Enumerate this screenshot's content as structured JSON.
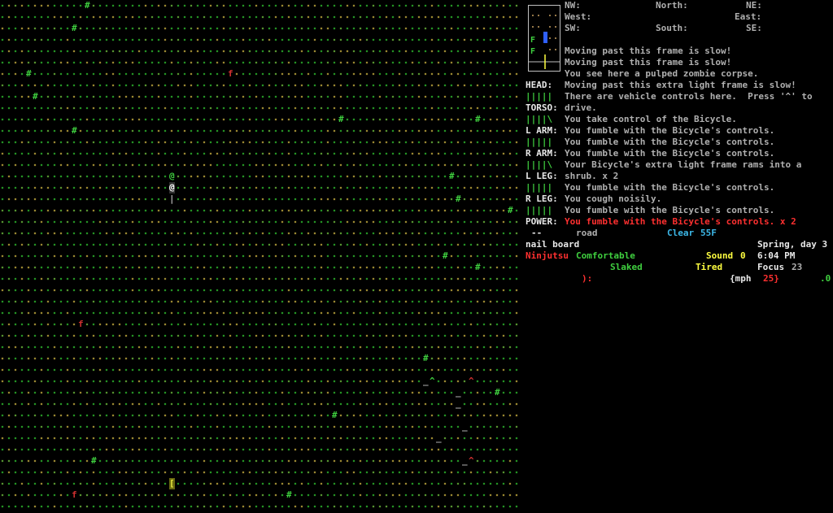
{
  "compass": {
    "nw": "NW:",
    "north": "North:",
    "ne": "NE:",
    "west": "West:",
    "east": "East:",
    "sw": "SW:",
    "south": "South:",
    "se": "SE:"
  },
  "body_status": [
    {
      "label": "HEAD:",
      "bar": "|||||"
    },
    {
      "label": "TORSO:",
      "bar": "||||\\"
    },
    {
      "label": "L ARM:",
      "bar": "|||||"
    },
    {
      "label": "R ARM:",
      "bar": "||||\\"
    },
    {
      "label": "L LEG:",
      "bar": "|||||"
    },
    {
      "label": "R LEG:",
      "bar": "|||||"
    },
    {
      "label": "POWER:",
      "bar": "--"
    }
  ],
  "messages": [
    {
      "text": "Moving past this frame is slow!",
      "color": "#b0b0b0"
    },
    {
      "text": "Moving past this frame is slow!",
      "color": "#b0b0b0"
    },
    {
      "text": "You see here a pulped zombie corpse.",
      "color": "#b0b0b0"
    },
    {
      "text": "Moving past this extra light frame is slow!",
      "color": "#b0b0b0"
    },
    {
      "text": "There are vehicle controls here.  Press '^' to",
      "color": "#b0b0b0"
    },
    {
      "text": "drive.",
      "color": "#b0b0b0"
    },
    {
      "text": "You take control of the Bicycle.",
      "color": "#b0b0b0"
    },
    {
      "text": "You fumble with the Bicycle's controls.",
      "color": "#b0b0b0"
    },
    {
      "text": "You fumble with the Bicycle's controls.",
      "color": "#b0b0b0"
    },
    {
      "text": "You fumble with the Bicycle's controls.",
      "color": "#b0b0b0"
    },
    {
      "text": "Your Bicycle's extra light frame rams into a",
      "color": "#b0b0b0"
    },
    {
      "text": "shrub. x 2",
      "color": "#b0b0b0"
    },
    {
      "text": "You fumble with the Bicycle's controls.",
      "color": "#b0b0b0"
    },
    {
      "text": "You cough noisily.",
      "color": "#b0b0b0"
    },
    {
      "text": "You fumble with the Bicycle's controls.",
      "color": "#b0b0b0"
    },
    {
      "text": "You fumble with the Bicycle's controls. x 2",
      "color": "#ff3030"
    }
  ],
  "status": {
    "terrain": "road",
    "weather": "Clear",
    "temperature": "55F",
    "wielded": "nail board",
    "date": "Spring, day 3",
    "time": "6:04 PM",
    "style": "Ninjutsu",
    "mood": "Comfortable",
    "thirst": "Slaked",
    "sound_label": "Sound",
    "sound_value": "0",
    "fatigue": "Tired",
    "focus_label": "Focus",
    "focus_value": "23",
    "face": "):",
    "speed_unit": "{mph",
    "speed_value": "25}",
    "speed_tail": ".0"
  },
  "map_glyphs": [
    {
      "ch": "#",
      "col": 13,
      "row": 0,
      "color": "#3fcf3f"
    },
    {
      "ch": "#",
      "col": 11,
      "row": 2,
      "color": "#3fcf3f"
    },
    {
      "ch": "#",
      "col": 4,
      "row": 6,
      "color": "#3fcf3f"
    },
    {
      "ch": "f",
      "col": 35,
      "row": 6,
      "color": "#d03030"
    },
    {
      "ch": "#",
      "col": 5,
      "row": 8,
      "color": "#3fcf3f"
    },
    {
      "ch": "#",
      "col": 52,
      "row": 10,
      "color": "#3fcf3f"
    },
    {
      "ch": "#",
      "col": 73,
      "row": 10,
      "color": "#3fcf3f"
    },
    {
      "ch": "#",
      "col": 11,
      "row": 11,
      "color": "#3fcf3f"
    },
    {
      "ch": "#",
      "col": 69,
      "row": 15,
      "color": "#3fcf3f"
    },
    {
      "ch": "@",
      "col": 26,
      "row": 15,
      "color": "#3fcf3f"
    },
    {
      "ch": "@",
      "col": 26,
      "row": 16,
      "color": "#ffffff"
    },
    {
      "ch": "|",
      "col": 26,
      "row": 17,
      "color": "#b0b0b0"
    },
    {
      "ch": "#",
      "col": 70,
      "row": 17,
      "color": "#3fcf3f"
    },
    {
      "ch": "#",
      "col": 78,
      "row": 18,
      "color": "#3fcf3f"
    },
    {
      "ch": "#",
      "col": 68,
      "row": 22,
      "color": "#3fcf3f"
    },
    {
      "ch": "#",
      "col": 73,
      "row": 23,
      "color": "#3fcf3f"
    },
    {
      "ch": "f",
      "col": 12,
      "row": 28,
      "color": "#d03030"
    },
    {
      "ch": "#",
      "col": 65,
      "row": 31,
      "color": "#3fcf3f"
    },
    {
      "ch": "^",
      "col": 66,
      "row": 33,
      "color": "#3fcf3f"
    },
    {
      "ch": "_",
      "col": 65,
      "row": 33,
      "color": "#b0b0b0"
    },
    {
      "ch": "^",
      "col": 72,
      "row": 33,
      "color": "#d03030"
    },
    {
      "ch": "#",
      "col": 76,
      "row": 34,
      "color": "#3fcf3f"
    },
    {
      "ch": "_",
      "col": 70,
      "row": 34,
      "color": "#b0b0b0"
    },
    {
      "ch": "_",
      "col": 70,
      "row": 35,
      "color": "#b0b0b0"
    },
    {
      "ch": "#",
      "col": 51,
      "row": 36,
      "color": "#3fcf3f"
    },
    {
      "ch": "_",
      "col": 71,
      "row": 37,
      "color": "#b0b0b0"
    },
    {
      "ch": "_",
      "col": 67,
      "row": 38,
      "color": "#b0b0b0"
    },
    {
      "ch": "#",
      "col": 14,
      "row": 40,
      "color": "#3fcf3f"
    },
    {
      "ch": "^",
      "col": 72,
      "row": 40,
      "color": "#d03030"
    },
    {
      "ch": "_",
      "col": 71,
      "row": 40,
      "color": "#b0b0b0"
    },
    {
      "ch": "[",
      "col": 26,
      "row": 42,
      "color": "#e8e840"
    },
    {
      "ch": "f",
      "col": 11,
      "row": 43,
      "color": "#d03030"
    },
    {
      "ch": "#",
      "col": 44,
      "row": 43,
      "color": "#3fcf3f"
    }
  ]
}
